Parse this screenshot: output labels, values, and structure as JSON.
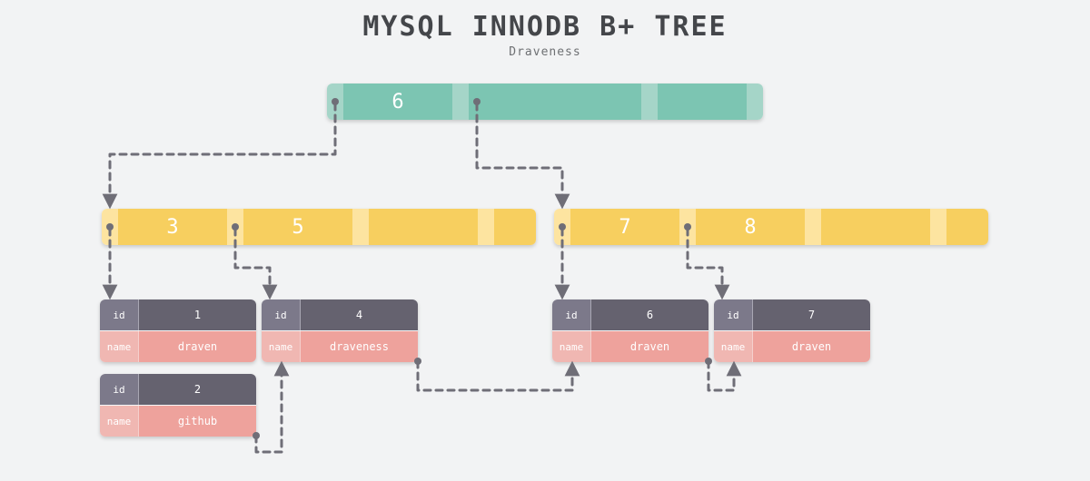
{
  "title": "MYSQL INNODB B+ TREE",
  "subtitle": "Draveness",
  "root": {
    "key": "6"
  },
  "leftNode": {
    "keys": [
      "3",
      "5"
    ]
  },
  "rightNode": {
    "keys": [
      "7",
      "8"
    ]
  },
  "records": [
    {
      "id": "1",
      "name": "draven"
    },
    {
      "id": "2",
      "name": "github"
    },
    {
      "id": "4",
      "name": "draveness"
    },
    {
      "id": "6",
      "name": "draven"
    },
    {
      "id": "7",
      "name": "draven"
    }
  ],
  "labels": {
    "id": "id",
    "name": "name"
  }
}
